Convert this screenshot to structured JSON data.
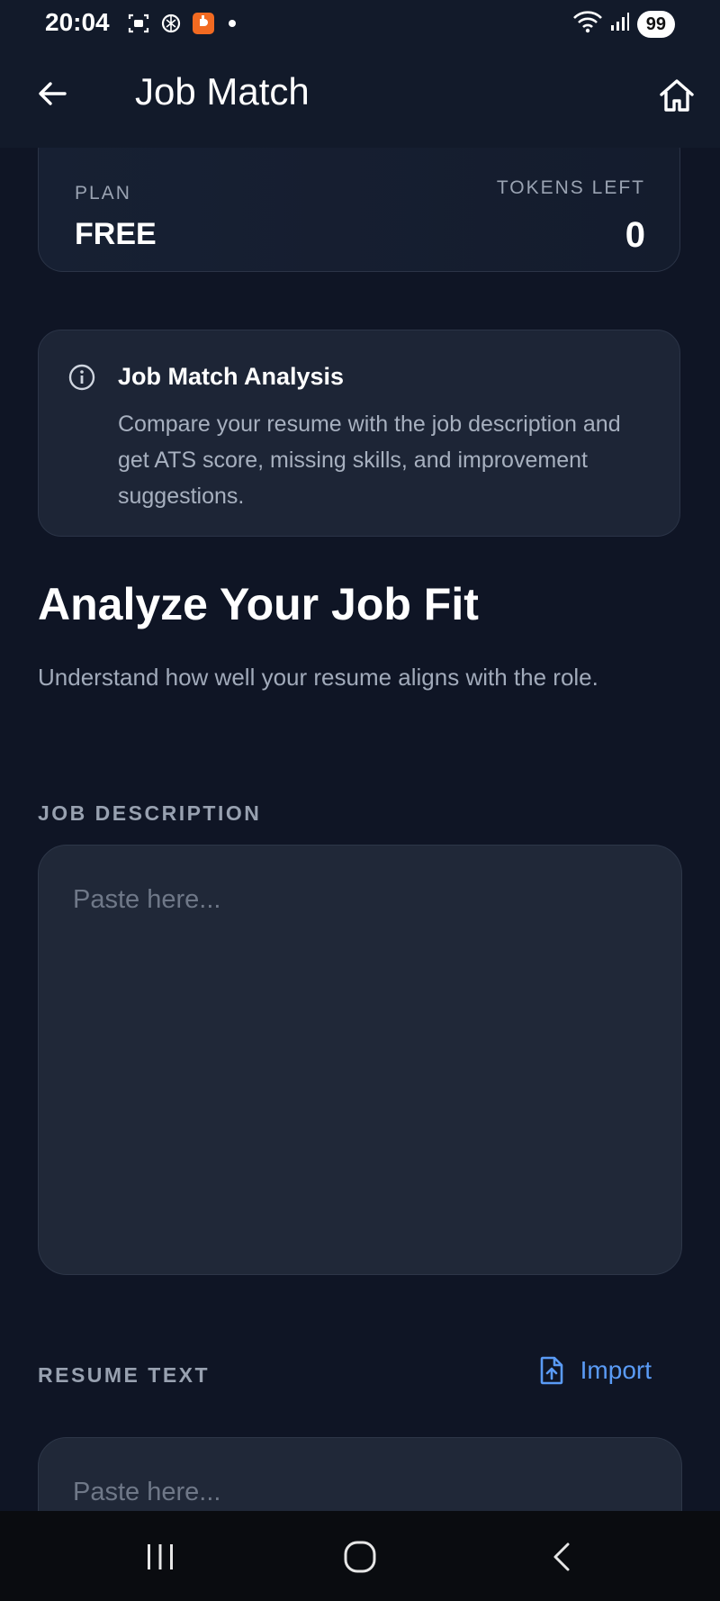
{
  "status_bar": {
    "time": "20:04",
    "battery": "99",
    "icons_left": [
      "screenshot-icon",
      "openai-icon",
      "app-notification-icon"
    ],
    "icons_right": [
      "wifi-icon",
      "signal-icon"
    ]
  },
  "app_bar": {
    "title": "Job Match",
    "back_icon": "arrow-left-icon",
    "home_icon": "home-icon"
  },
  "plan_card": {
    "plan_label": "PLAN",
    "plan_value": "FREE",
    "tokens_label": "TOKENS LEFT",
    "tokens_value": "0"
  },
  "info_card": {
    "icon": "info-icon",
    "title": "Job Match Analysis",
    "text": "Compare your resume with the job description and get ATS score, missing skills, and improvement suggestions."
  },
  "section": {
    "title": "Analyze Your Job Fit",
    "subtitle": "Understand how well your resume aligns with the role."
  },
  "job_description": {
    "label": "JOB DESCRIPTION",
    "placeholder": "Paste here...",
    "value": ""
  },
  "resume": {
    "label": "RESUME TEXT",
    "import_label": "Import",
    "import_icon": "file-upload-icon",
    "placeholder": "Paste here...",
    "value": ""
  },
  "nav_bar": {
    "buttons": [
      "recents-icon",
      "home-circle-icon",
      "chevron-left-icon"
    ]
  },
  "colors": {
    "background": "#0f1525",
    "card": "#1d2536",
    "accent": "#5a9bf6",
    "text_primary": "#ffffff",
    "text_secondary": "#a1aaba"
  }
}
